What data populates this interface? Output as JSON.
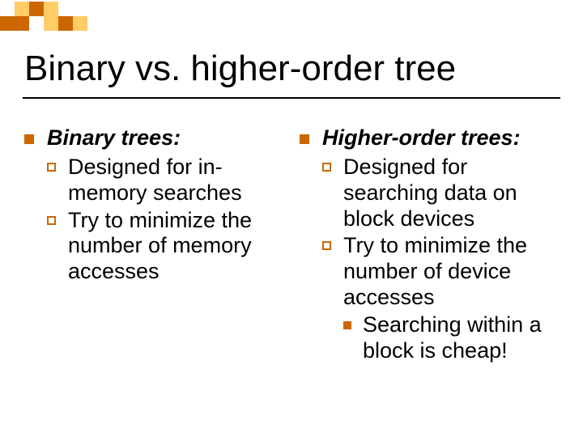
{
  "title": "Binary vs. higher-order  tree",
  "left": {
    "heading": "Binary trees:",
    "sub1": "Designed for in-memory searches",
    "sub2": "Try to minimize the number of memory accesses"
  },
  "right": {
    "heading": "Higher-order trees:",
    "sub1": "Designed for searching data on block devices",
    "sub2": "Try to minimize the number of device accesses",
    "sub3": "Searching within a block is cheap!"
  }
}
